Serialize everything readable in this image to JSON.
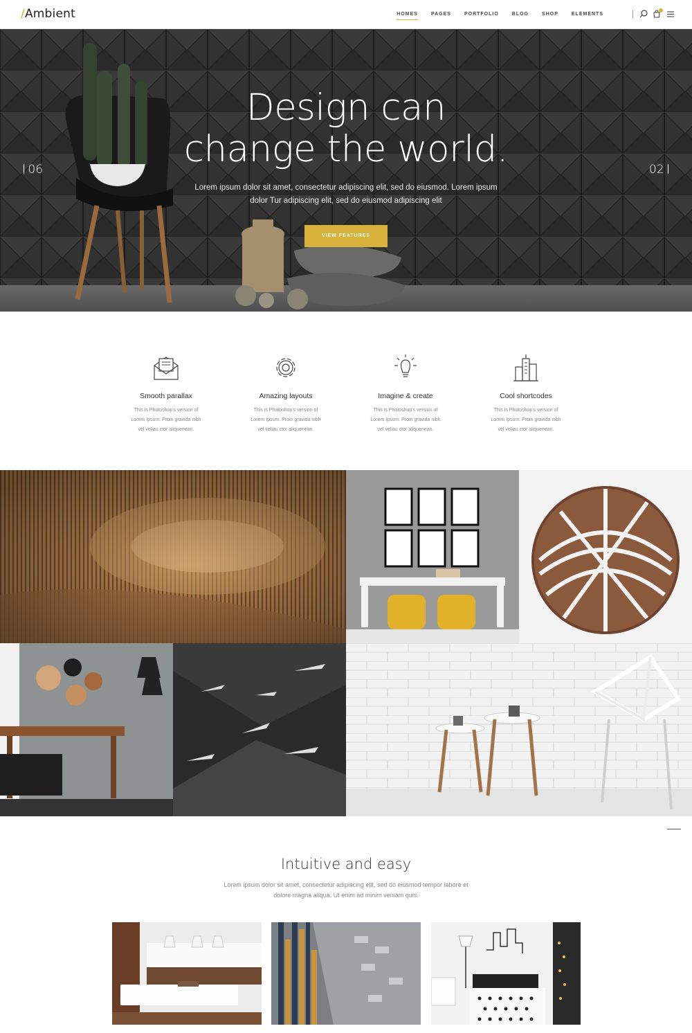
{
  "header": {
    "logo_slash": "/",
    "logo": "Ambient",
    "nav": [
      "HOMES",
      "PAGES",
      "PORTFOLIO",
      "BLOG",
      "SHOP",
      "ELEMENTS"
    ],
    "active_nav": "HOMES",
    "accent_color": "#d8b23a"
  },
  "hero": {
    "title_line1": "Design can",
    "title_line2": "change the world.",
    "subtitle": "Lorem ipsum dolor sit amet, consectetur adipiscing elit, sed do eiusmod. Lorem ipsum dolor Tur adipiscing elit, sed do eiusmod adipiscing elit",
    "button": "VIEW FEATURES",
    "slide_prev": "06",
    "slide_next": "02"
  },
  "features": [
    {
      "icon": "envelope-icon",
      "title": "Smooth parallax",
      "text": "This is Photoshop's version of Lorem Ipsum. Proin gravida nibh vel veliau ctor aliquenean."
    },
    {
      "icon": "gear-icon",
      "title": "Amazing layouts",
      "text": "This is Photoshop's version of Lorem Ipsum. Proin gravida nibh vel veliau ctor aliquenean."
    },
    {
      "icon": "lightbulb-icon",
      "title": "Imagine & create",
      "text": "This is Photoshop's version of Lorem Ipsum. Proin gravida nibh vel veliau ctor aliquenean."
    },
    {
      "icon": "buildings-icon",
      "title": "Cool shortcodes",
      "text": "This is Photoshop's version of Lorem Ipsum. Proin gravida nibh vel veliau ctor aliquenean."
    }
  ],
  "section2": {
    "title": "Intuitive and easy",
    "subtitle": "Lorem ipsum dolor sit amet, consectetur adipiscing elit, sed do eiusmod tempor labore et dolore magna aliqua. Ut enim ad minim veniam quis."
  }
}
